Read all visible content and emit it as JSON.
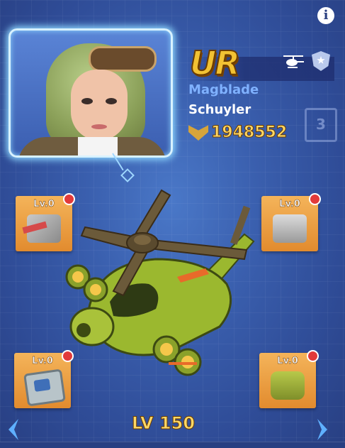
{
  "rarity": "UR",
  "class_name": "Magblade",
  "pilot_name": "Schuyler",
  "power": "1948552",
  "star_level": "3",
  "level_label": "LV 150",
  "slots": [
    {
      "label": "Lv.0",
      "icon": "turret-gun-icon"
    },
    {
      "label": "Lv.0",
      "icon": "armor-plate-icon"
    },
    {
      "label": "Lv.0",
      "icon": "radar-panel-icon"
    },
    {
      "label": "Lv.0",
      "icon": "engine-mount-icon"
    }
  ],
  "icons": {
    "info": "info-icon",
    "vehicle_type": "helicopter-icon",
    "rank": "shield-star-icon",
    "power": "power-wings-icon",
    "prev": "chevron-left-icon",
    "next": "chevron-right-icon"
  },
  "colors": {
    "background": "#3a5fae",
    "rarity": "#f2c233",
    "class_name": "#7fb1ff",
    "power": "#ffd866",
    "slot": "#e8993a",
    "notification": "#e23a3a",
    "helicopter_body": "#9bb82f"
  }
}
